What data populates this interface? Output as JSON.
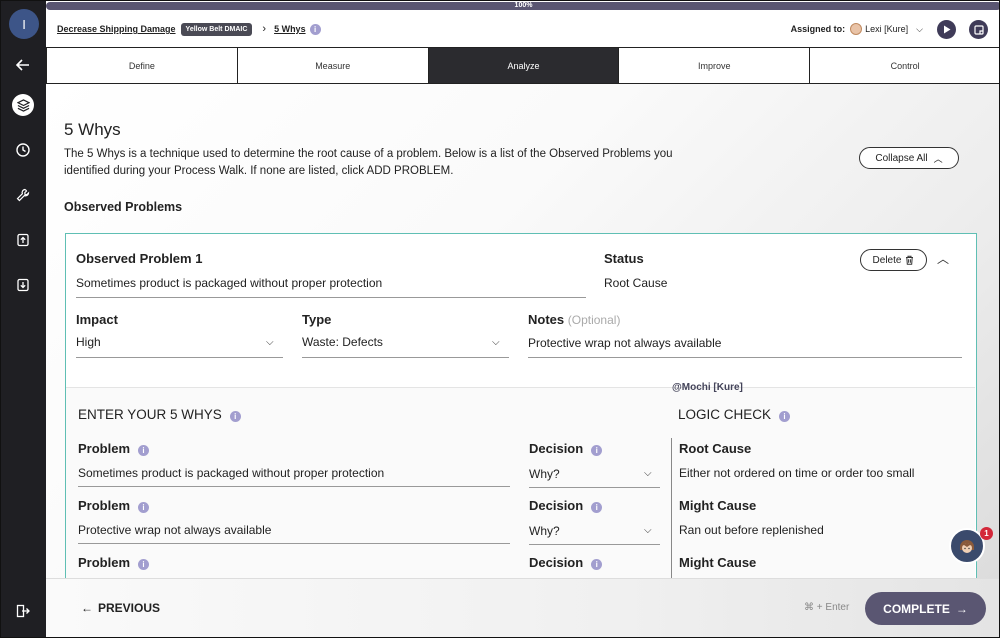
{
  "progress": {
    "label": "100%",
    "value": 1.0
  },
  "breadcrumb": {
    "project": "Decrease Shipping Damage",
    "badge": "Yellow Belt DMAIC",
    "separator": "›",
    "current": "5 Whys",
    "info": "i"
  },
  "assigned": {
    "label": "Assigned to:",
    "user": "Lexi [Kure]"
  },
  "tabs": [
    {
      "label": "Define",
      "active": false
    },
    {
      "label": "Measure",
      "active": false
    },
    {
      "label": "Analyze",
      "active": true
    },
    {
      "label": "Improve",
      "active": false
    },
    {
      "label": "Control",
      "active": false
    }
  ],
  "page": {
    "title": "5 Whys",
    "description": "The 5 Whys is a technique used to determine the root cause of a problem. Below is a list of the Observed Problems you identified during your Process Walk. If none are listed, click ADD PROBLEM.",
    "collapse_all": "Collapse All",
    "observed_heading": "Observed Problems"
  },
  "problem": {
    "title": "Observed Problem 1",
    "text": "Sometimes product is packaged without proper protection",
    "status_label": "Status",
    "status_value": "Root Cause",
    "delete_label": "Delete",
    "impact_label": "Impact",
    "impact_value": "High",
    "type_label": "Type",
    "type_value": "Waste: Defects",
    "notes_label": "Notes",
    "notes_optional": "(Optional)",
    "notes_value": "Protective wrap not always available"
  },
  "mention": "@Mochi [Kure]",
  "whys": {
    "heading": "ENTER YOUR 5 WHYS",
    "rows": [
      {
        "problem_label": "Problem",
        "problem_value": "Sometimes product is packaged without proper protection",
        "decision_label": "Decision",
        "decision_value": "Why?"
      },
      {
        "problem_label": "Problem",
        "problem_value": "Protective wrap not always available",
        "decision_label": "Decision",
        "decision_value": "Why?"
      },
      {
        "problem_label": "Problem",
        "problem_value": "",
        "decision_label": "Decision",
        "decision_value": ""
      }
    ]
  },
  "logic": {
    "heading": "LOGIC CHECK",
    "rows": [
      {
        "label": "Root Cause",
        "value": "Either not ordered on time or order too small"
      },
      {
        "label": "Might Cause",
        "value": "Ran out before replenished"
      },
      {
        "label": "Might Cause",
        "value": ""
      }
    ]
  },
  "footer": {
    "previous": "PREVIOUS",
    "hint": "⌘ + Enter",
    "complete": "COMPLETE"
  },
  "chat_badge": "1",
  "sidebar": {
    "logo": "I"
  },
  "colors": {
    "accent": "#5a5672",
    "card_border": "#5fbfb4",
    "info": "#a29ecf",
    "sidebar": "#1f1f23"
  }
}
